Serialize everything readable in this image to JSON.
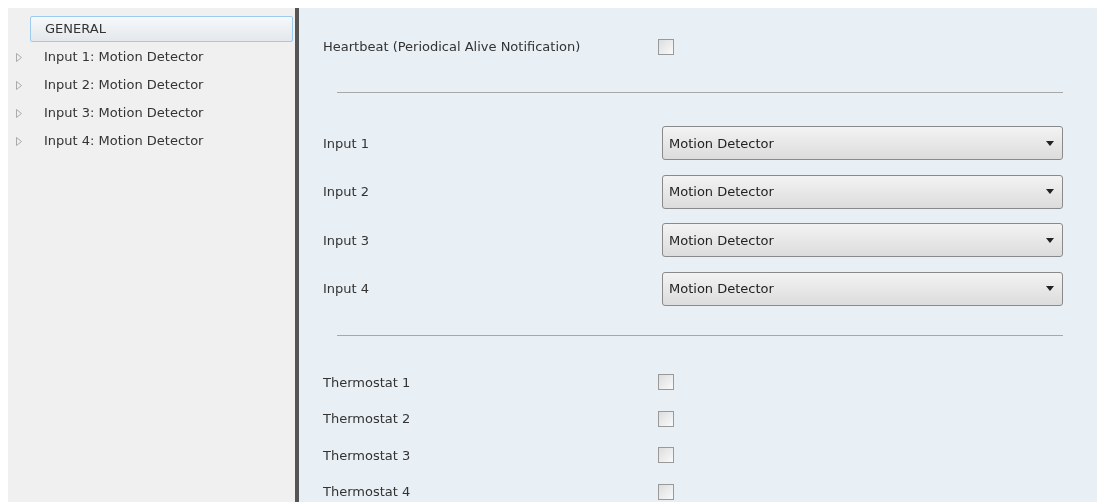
{
  "sidebar": {
    "items": [
      {
        "label": "GENERAL",
        "selected": true,
        "expandable": false
      },
      {
        "label": "Input 1: Motion Detector",
        "selected": false,
        "expandable": true
      },
      {
        "label": "Input 2: Motion Detector",
        "selected": false,
        "expandable": true
      },
      {
        "label": "Input 3: Motion Detector",
        "selected": false,
        "expandable": true
      },
      {
        "label": "Input 4: Motion Detector",
        "selected": false,
        "expandable": true
      }
    ]
  },
  "rows": [
    {
      "kind": "checkbox",
      "label": "Heartbeat (Periodical Alive Notification)",
      "checked": false
    },
    {
      "kind": "divider"
    },
    {
      "kind": "select",
      "label": "Input 1",
      "value": "Motion Detector"
    },
    {
      "kind": "select",
      "label": "Input 2",
      "value": "Motion Detector"
    },
    {
      "kind": "select",
      "label": "Input 3",
      "value": "Motion Detector"
    },
    {
      "kind": "select",
      "label": "Input 4",
      "value": "Motion Detector"
    },
    {
      "kind": "divider"
    },
    {
      "kind": "checkbox",
      "label": "Thermostat 1",
      "checked": false
    },
    {
      "kind": "checkbox",
      "label": "Thermostat 2",
      "checked": false
    },
    {
      "kind": "checkbox",
      "label": "Thermostat 3",
      "checked": false
    },
    {
      "kind": "checkbox",
      "label": "Thermostat 4",
      "checked": false
    }
  ]
}
